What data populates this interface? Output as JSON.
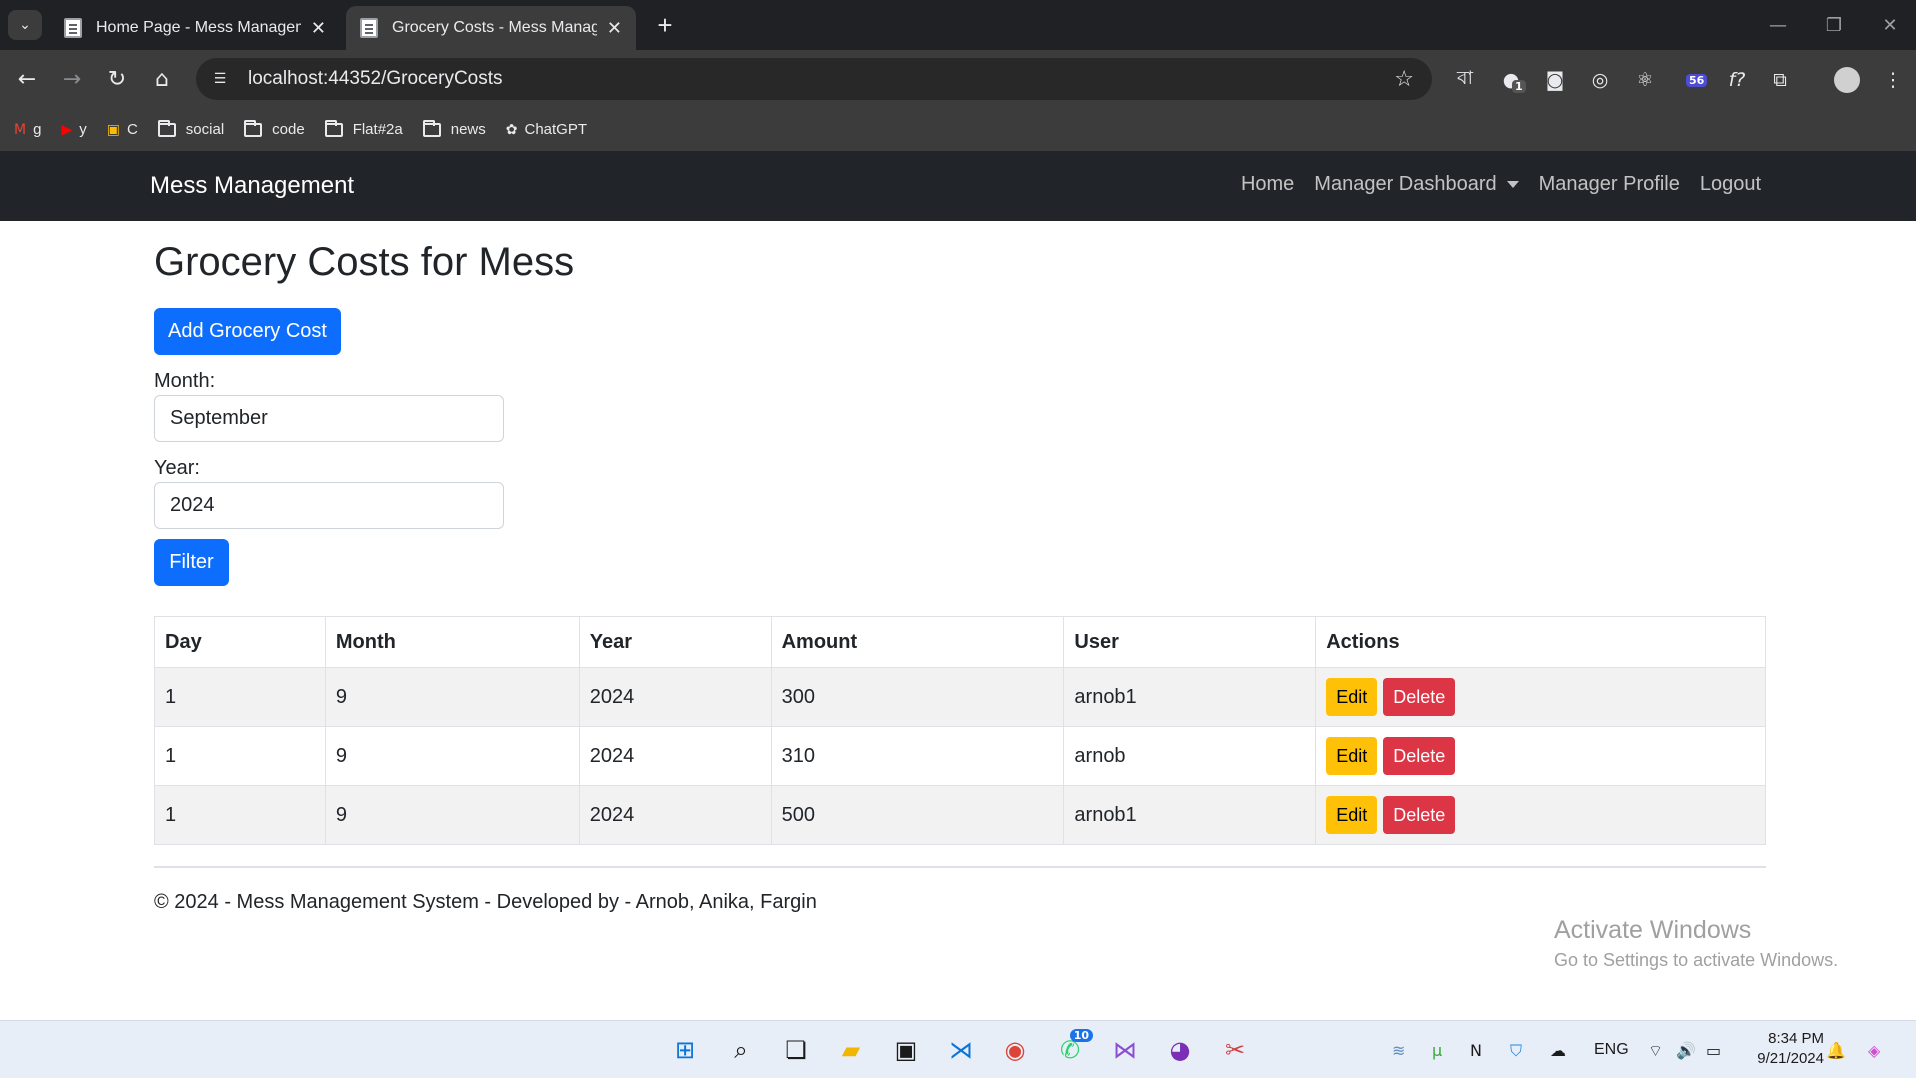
{
  "browser": {
    "tabs": [
      {
        "title": "Home Page - Mess Management"
      },
      {
        "title": "Grocery Costs - Mess Management"
      }
    ],
    "url": "localhost:44352/GroceryCosts",
    "bookmarks": [
      {
        "label": "g",
        "icon": "gmail-icon"
      },
      {
        "label": "y",
        "icon": "youtube-icon"
      },
      {
        "label": "C",
        "icon": "classroom-icon"
      },
      {
        "label": "social",
        "icon": "folder-icon"
      },
      {
        "label": "code",
        "icon": "folder-icon"
      },
      {
        "label": "Flat#2a",
        "icon": "folder-icon"
      },
      {
        "label": "news",
        "icon": "folder-icon"
      },
      {
        "label": "ChatGPT",
        "icon": "chatgpt-icon"
      }
    ],
    "extensions": {
      "bangla_label": "বা",
      "notif_badge": "1",
      "ext_badge": "56",
      "fx_label": "f?"
    }
  },
  "navbar": {
    "brand": "Mess Management",
    "links": {
      "home": "Home",
      "dashboard": "Manager Dashboard",
      "profile": "Manager Profile",
      "logout": "Logout"
    }
  },
  "main": {
    "title": "Grocery Costs for Mess",
    "add_button": "Add Grocery Cost",
    "month_label": "Month:",
    "month_value": "September",
    "year_label": "Year:",
    "year_value": "2024",
    "filter_button": "Filter"
  },
  "table": {
    "headers": [
      "Day",
      "Month",
      "Year",
      "Amount",
      "User",
      "Actions"
    ],
    "rows": [
      {
        "day": "1",
        "month": "9",
        "year": "2024",
        "amount": "300",
        "user": "arnob1"
      },
      {
        "day": "1",
        "month": "9",
        "year": "2024",
        "amount": "310",
        "user": "arnob"
      },
      {
        "day": "1",
        "month": "9",
        "year": "2024",
        "amount": "500",
        "user": "arnob1"
      }
    ],
    "edit_label": "Edit",
    "delete_label": "Delete"
  },
  "footer": {
    "text": "© 2024 - Mess Management System - Developed by - Arnob, Anika, Fargin"
  },
  "watermark": {
    "line1": "Activate Windows",
    "line2": "Go to Settings to activate Windows."
  },
  "taskbar": {
    "whatsapp_badge": "10",
    "lang": "ENG",
    "time": "8:34 PM",
    "date": "9/21/2024"
  },
  "colors": {
    "primary": "#0d6efd",
    "warning": "#ffc107",
    "danger": "#dc3545",
    "navbar": "#212529"
  }
}
